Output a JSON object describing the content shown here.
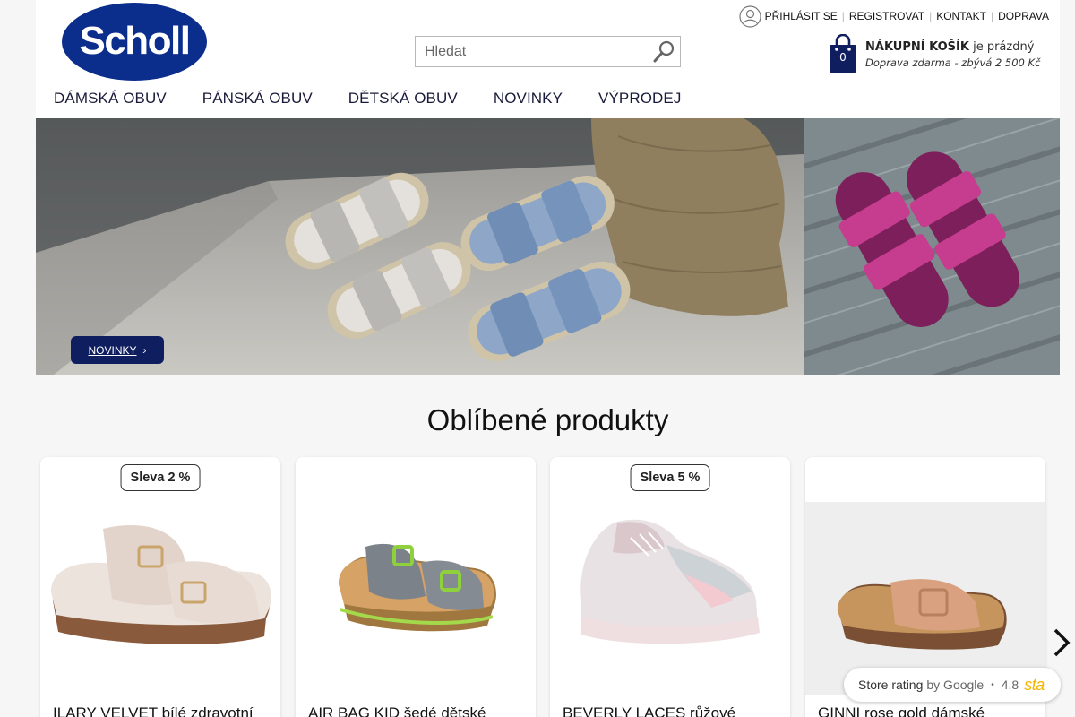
{
  "brand": {
    "logo_text": "Scholl",
    "color": "#0b2d8c"
  },
  "search": {
    "placeholder": "Hledat"
  },
  "top_links": {
    "login": "PŘIHLÁSIT SE",
    "register": "REGISTROVAT",
    "contact": "KONTAKT",
    "shipping": "DOPRAVA"
  },
  "cart": {
    "count": "0",
    "title": "NÁKUPNÍ KOŠÍK",
    "status": "je prázdný",
    "note": "Doprava zdarma - zbývá 2 500 Kč"
  },
  "nav": {
    "women": "DÁMSKÁ OBUV",
    "men": "PÁNSKÁ OBUV",
    "kids": "DĚTSKÁ OBUV",
    "new": "NOVINKY",
    "sale": "VÝPRODEJ"
  },
  "hero": {
    "button_label": "NOVINKY"
  },
  "section": {
    "title": "Oblíbené produkty"
  },
  "products": [
    {
      "badge": "Sleva 2 %",
      "name": "ILARY VELVET bílé zdravotní"
    },
    {
      "badge": "",
      "name": "AIR BAG KID šedé dětské"
    },
    {
      "badge": "Sleva 5 %",
      "name": "BEVERLY LACES růžové"
    },
    {
      "badge": "",
      "name": "GINNI rose gold dámské"
    }
  ],
  "rating": {
    "label": "Store rating",
    "by": "by Google",
    "score": "4.8",
    "stars_text": "sta"
  },
  "icons": {
    "user": "user-icon",
    "search": "search-icon",
    "cart": "shopping-bag-icon",
    "next": "chevron-right-icon"
  }
}
